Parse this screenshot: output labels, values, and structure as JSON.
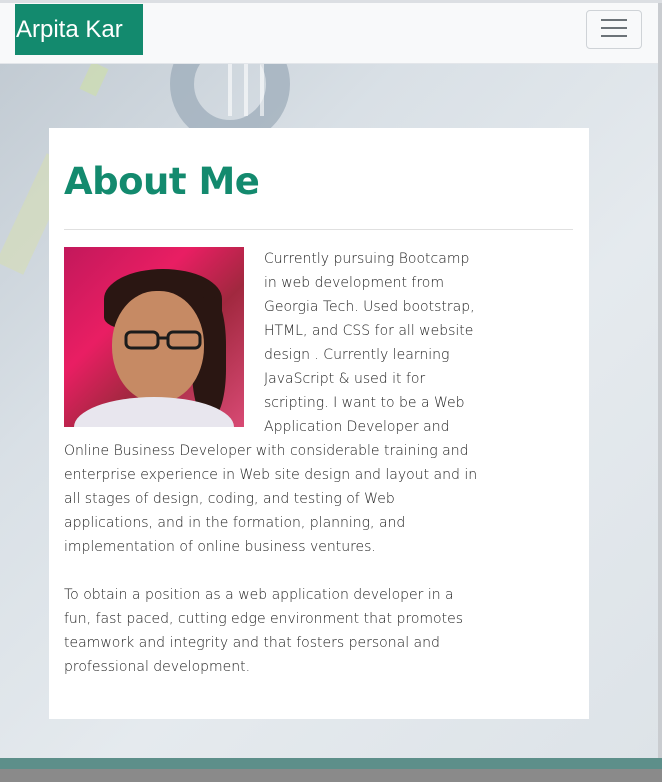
{
  "navbar": {
    "brand": "Arpita Kar",
    "toggler_icon": "hamburger-menu-icon"
  },
  "about": {
    "title": "About Me",
    "photo_alt": "profile-photo",
    "paragraph1": "Currently pursuing Bootcamp in web development from Georgia Tech. Used bootstrap, HTML, and CSS for all website design . Currently learning JavaScript & used it for scripting. I want to be a Web Application Developer and Online Business Developer with considerable training and enterprise experience in Web site design and layout and in all stages of design, coding, and testing of Web applications, and in the formation, planning, and implementation of online business ventures.",
    "paragraph2": "To obtain a position as a web application developer in a fun, fast paced, cutting edge environment that promotes teamwork and integrity and that fosters personal and professional development."
  },
  "colors": {
    "accent": "#138a6e",
    "footer": "#5d8f8a"
  }
}
